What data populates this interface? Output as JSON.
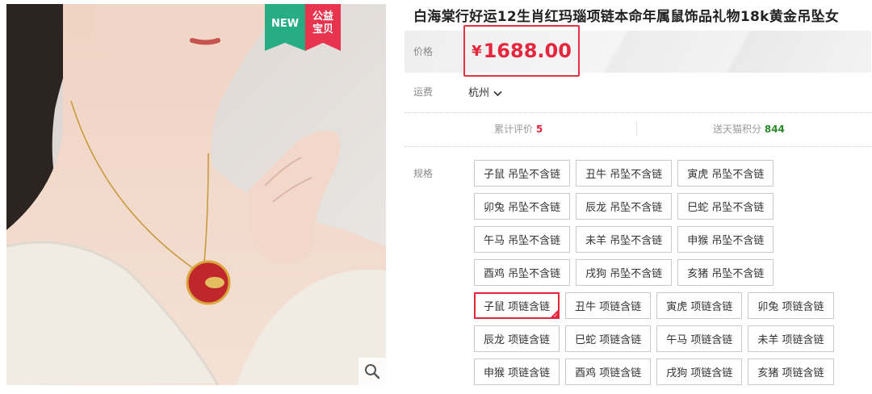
{
  "gallery": {
    "badge_new": "NEW",
    "badge_charity_line1": "公益",
    "badge_charity_line2": "宝贝",
    "zoom_icon": "search-icon"
  },
  "product": {
    "title": "白海棠行好运12生肖红玛瑙项链本命年属鼠饰品礼物18k黄金吊坠女",
    "price_label": "价格",
    "price_currency": "¥",
    "price_value": "1688.00",
    "shipping_label": "运费",
    "shipping_from": "杭州",
    "reviews_label": "累计评价",
    "reviews_count": "5",
    "points_label": "送天猫积分",
    "points_value": "844",
    "spec_label": "规格"
  },
  "specs": [
    [
      "子鼠 吊坠不含链",
      "丑牛 吊坠不含链",
      "寅虎 吊坠不含链"
    ],
    [
      "卯兔 吊坠不含链",
      "辰龙 吊坠不含链",
      "巳蛇 吊坠不含链"
    ],
    [
      "午马 吊坠不含链",
      "未羊 吊坠不含链",
      "申猴 吊坠不含链"
    ],
    [
      "酉鸡 吊坠不含链",
      "戌狗 吊坠不含链",
      "亥猪 吊坠不含链"
    ],
    [
      "子鼠 项链含链",
      "丑牛 项链含链",
      "寅虎 项链含链",
      "卯兔 项链含链"
    ],
    [
      "辰龙 项链含链",
      "巳蛇 项链含链",
      "午马 项链含链",
      "未羊 项链含链"
    ],
    [
      "申猴 项链含链",
      "酉鸡 项链含链",
      "戌狗 项链含链",
      "亥猪 项链含链"
    ]
  ],
  "selected_spec": "子鼠 项链含链",
  "colors": {
    "accent_red": "#e5263c",
    "badge_green": "#27ad84",
    "badge_red": "#e8344f",
    "points_green": "#2c8a2c"
  }
}
